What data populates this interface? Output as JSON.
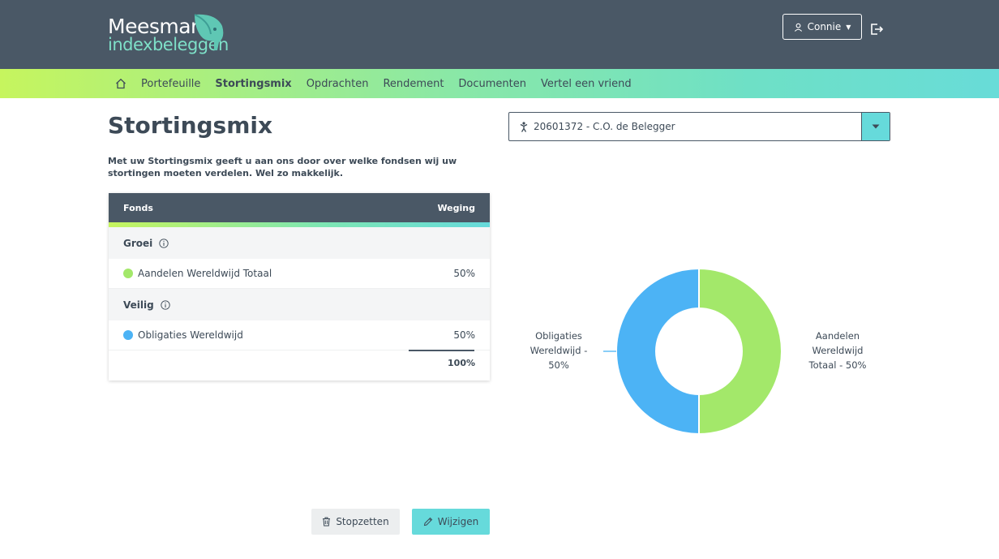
{
  "brand": {
    "word1": "Meesman",
    "word2": "indexbeleggen"
  },
  "header": {
    "user_label": "Connie"
  },
  "nav": {
    "items": [
      {
        "label": "Portefeuille"
      },
      {
        "label": "Stortingsmix",
        "active": true
      },
      {
        "label": "Opdrachten"
      },
      {
        "label": "Rendement"
      },
      {
        "label": "Documenten"
      },
      {
        "label": "Vertel een vriend"
      }
    ]
  },
  "page": {
    "title": "Stortingsmix",
    "intro": "Met uw Stortingsmix geeft u aan ons door over welke fondsen wij uw stortingen moeten verdelen. Wel zo makkelijk."
  },
  "table": {
    "col_fund": "Fonds",
    "col_weight": "Weging",
    "groups": [
      {
        "name": "Groei",
        "fund": "Aandelen Wereldwijd Totaal",
        "weight": "50%",
        "color": "#a3e86a"
      },
      {
        "name": "Veilig",
        "fund": "Obligaties Wereldwijd",
        "weight": "50%",
        "color": "#4cb3f5"
      }
    ],
    "total": "100%"
  },
  "account": {
    "label": "20601372 - C.O. de Belegger"
  },
  "chart_data": {
    "type": "pie",
    "labels": [
      "Aandelen Wereldwijd Totaal",
      "Obligaties Wereldwijd"
    ],
    "values": [
      50,
      50
    ],
    "colors": [
      "#a3e86a",
      "#4cb3f5"
    ],
    "annotations": {
      "right": [
        "Aandelen",
        "Wereldwijd",
        "Totaal - 50%"
      ],
      "left": [
        "Obligaties",
        "Wereldwijd -",
        "50%"
      ]
    }
  },
  "actions": {
    "stop_label": "Stopzetten",
    "edit_label": "Wijzigen"
  }
}
